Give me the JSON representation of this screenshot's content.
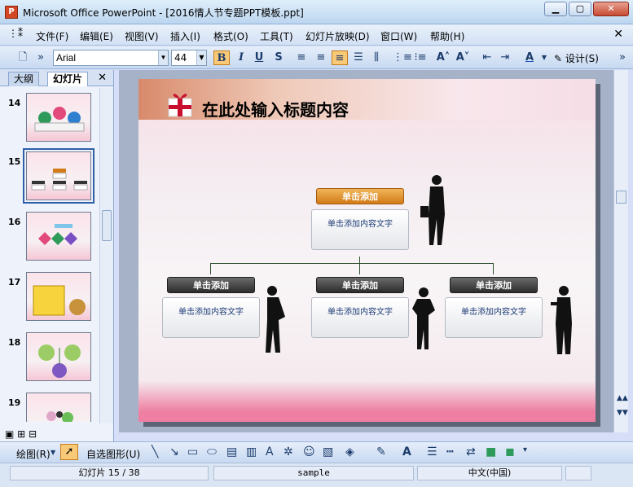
{
  "window": {
    "app_badge": "P",
    "title": "Microsoft Office PowerPoint - [2016情人节专题PPT模板.ppt]"
  },
  "menus": [
    "文件(F)",
    "编辑(E)",
    "视图(V)",
    "插入(I)",
    "格式(O)",
    "工具(T)",
    "幻灯片放映(D)",
    "窗口(W)",
    "帮助(H)"
  ],
  "toolbar": {
    "font": "Arial",
    "size": "44",
    "bold": "B",
    "italic": "I",
    "underline": "U",
    "shadow": "S",
    "design": "设计(S)"
  },
  "left_pane": {
    "tabs": [
      "大纲",
      "幻灯片"
    ],
    "thumbnails": [
      {
        "number": "14"
      },
      {
        "number": "15",
        "selected": true
      },
      {
        "number": "16"
      },
      {
        "number": "17"
      },
      {
        "number": "18"
      },
      {
        "number": "19"
      }
    ]
  },
  "slide": {
    "title": "在此处输入标题内容",
    "top_box": {
      "heading": "单击添加",
      "content": "单击添加内容文字"
    },
    "children": [
      {
        "heading": "单击添加",
        "content": "单击添加内容文字"
      },
      {
        "heading": "单击添加",
        "content": "单击添加内容文字"
      },
      {
        "heading": "单击添加",
        "content": "单击添加内容文字"
      }
    ],
    "colors": {
      "accent": "#d27a16",
      "dark": "#2c2c2c",
      "content_text": "#1d3a75"
    }
  },
  "drawing_toolbar": {
    "draw": "绘图(R)",
    "autoshapes": "自选图形(U)"
  },
  "status": {
    "slide": "幻灯片 15 / 38",
    "design": "sample",
    "language": "中文(中国)"
  }
}
